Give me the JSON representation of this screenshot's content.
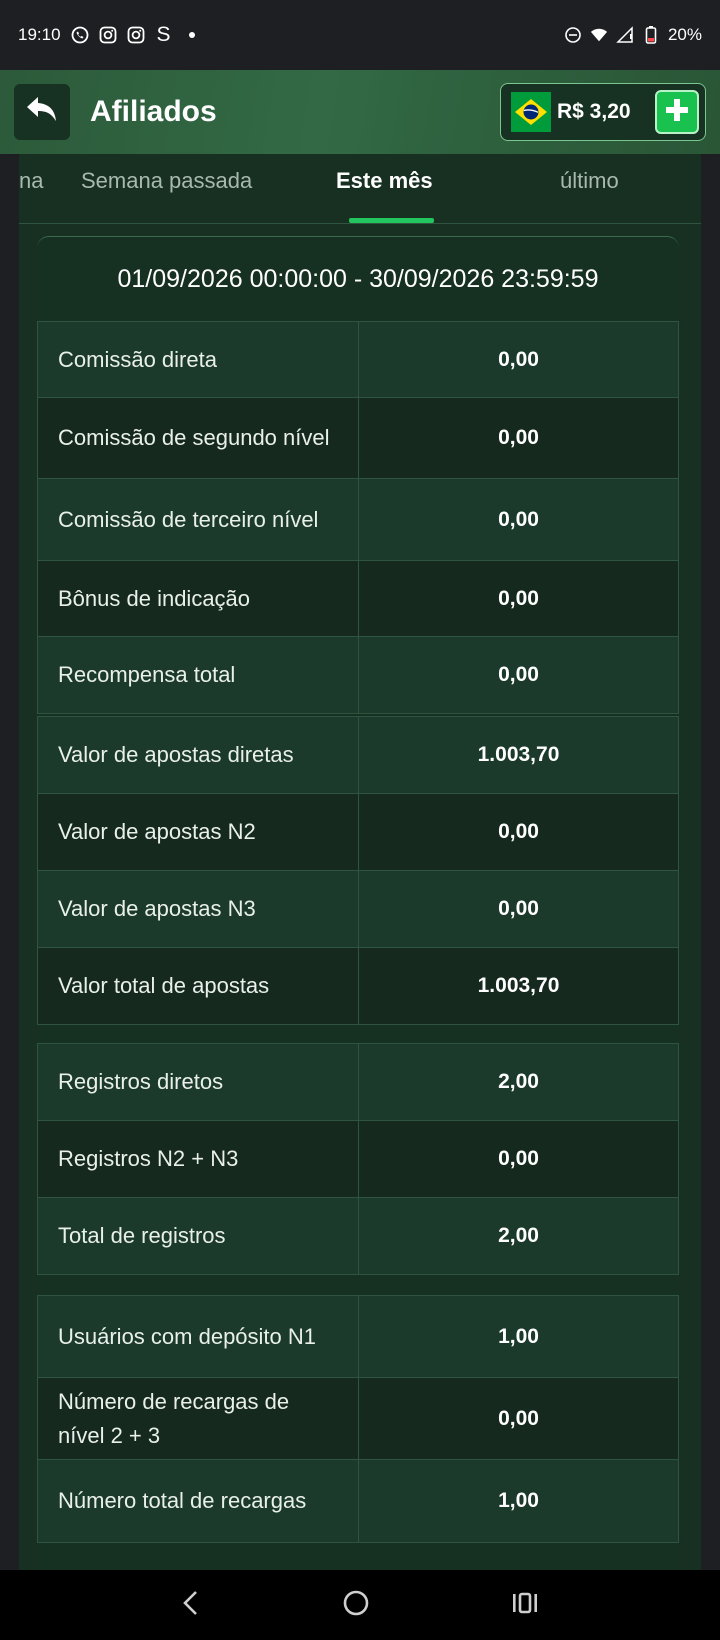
{
  "status_bar": {
    "time": "19:10",
    "left_icons": [
      "whatsapp-icon",
      "instagram-icon",
      "instagram-icon",
      "s-app-icon",
      "dot-icon"
    ],
    "s_glyph": "S",
    "battery": "20%"
  },
  "header": {
    "title": "Afiliados",
    "balance": "R$ 3,20",
    "flag": "brazil-flag-icon"
  },
  "tabs": [
    {
      "label": "na"
    },
    {
      "label": "Semana passada"
    },
    {
      "label": "Este mês"
    },
    {
      "label": "último"
    }
  ],
  "active_tab": "Este mês",
  "date_range": "01/09/2026 00:00:00 - 30/09/2026 23:59:59",
  "tables": [
    {
      "rows": [
        {
          "label": "Comissão direta",
          "value": "0,00"
        },
        {
          "label": "Comissão de segundo nível",
          "value": "0,00"
        },
        {
          "label": "Comissão de terceiro nível",
          "value": "0,00"
        },
        {
          "label": "Bônus de indicação",
          "value": "0,00"
        },
        {
          "label": "Recompensa total",
          "value": "0,00"
        }
      ]
    },
    {
      "rows": [
        {
          "label": "Valor de apostas diretas",
          "value": "1.003,70"
        },
        {
          "label": "Valor de apostas N2",
          "value": "0,00"
        },
        {
          "label": "Valor de apostas N3",
          "value": "0,00"
        },
        {
          "label": "Valor total de apostas",
          "value": "1.003,70"
        }
      ]
    },
    {
      "rows": [
        {
          "label": "Registros diretos",
          "value": "2,00"
        },
        {
          "label": "Registros N2 + N3",
          "value": "0,00"
        },
        {
          "label": "Total de registros",
          "value": "2,00"
        }
      ]
    },
    {
      "rows": [
        {
          "label": "Usuários com depósito N1",
          "value": "1,00"
        },
        {
          "label": "Número de recargas de nível 2 + 3",
          "value": "0,00"
        },
        {
          "label": "Número total de recargas",
          "value": "1,00"
        }
      ]
    }
  ],
  "colors": {
    "accent": "#22c55e",
    "header": "#2f6340",
    "panel": "#173022"
  }
}
